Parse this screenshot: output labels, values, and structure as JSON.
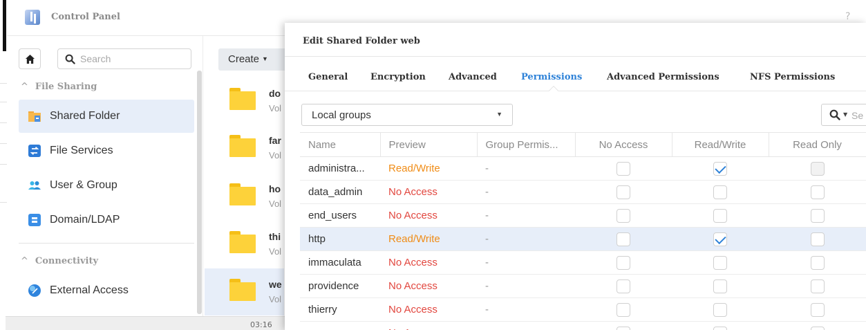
{
  "window": {
    "title": "Control Panel",
    "help": "?"
  },
  "sidebar": {
    "search_placeholder": "Search",
    "sections": [
      {
        "label": "File Sharing"
      },
      {
        "label": "Connectivity"
      }
    ],
    "items": [
      {
        "label": "Shared Folder",
        "icon": "shared-folder-icon",
        "active": true
      },
      {
        "label": "File Services",
        "icon": "file-services-icon"
      },
      {
        "label": "User & Group",
        "icon": "user-group-icon"
      },
      {
        "label": "Domain/LDAP",
        "icon": "domain-ldap-icon"
      },
      {
        "label": "External Access",
        "icon": "external-access-icon"
      }
    ]
  },
  "folder_list": {
    "create_label": "Create",
    "folders": [
      {
        "name": "do",
        "sub": "Vol"
      },
      {
        "name": "far",
        "sub": "Vol"
      },
      {
        "name": "ho",
        "sub": "Vol"
      },
      {
        "name": "thi",
        "sub": "Vol"
      },
      {
        "name": "we",
        "sub": "Vol",
        "selected": true
      }
    ]
  },
  "statusbar": {
    "time": "03:16"
  },
  "dialog": {
    "title": "Edit Shared Folder web",
    "tabs": [
      {
        "label": "General"
      },
      {
        "label": "Encryption"
      },
      {
        "label": "Advanced"
      },
      {
        "label": "Permissions",
        "active": true
      },
      {
        "label": "Advanced Permissions"
      },
      {
        "label": "NFS Permissions"
      }
    ],
    "group_select": {
      "value": "Local groups"
    },
    "filter_placeholder": "Se",
    "table": {
      "columns": [
        "Name",
        "Preview",
        "Group Permis...",
        "No Access",
        "Read/Write",
        "Read Only"
      ],
      "rows": [
        {
          "name": "administra...",
          "preview": "Read/Write",
          "group": "-",
          "no_access": false,
          "read_write": true,
          "read_only": false,
          "read_only_disabled": true
        },
        {
          "name": "data_admin",
          "preview": "No Access",
          "group": "-",
          "no_access": false,
          "read_write": false,
          "read_only": false
        },
        {
          "name": "end_users",
          "preview": "No Access",
          "group": "-",
          "no_access": false,
          "read_write": false,
          "read_only": false
        },
        {
          "name": "http",
          "preview": "Read/Write",
          "group": "-",
          "no_access": false,
          "read_write": true,
          "read_only": false,
          "selected": true
        },
        {
          "name": "immaculata",
          "preview": "No Access",
          "group": "-",
          "no_access": false,
          "read_write": false,
          "read_only": false
        },
        {
          "name": "providence",
          "preview": "No Access",
          "group": "-",
          "no_access": false,
          "read_write": false,
          "read_only": false
        },
        {
          "name": "thierry",
          "preview": "No Access",
          "group": "-",
          "no_access": false,
          "read_write": false,
          "read_only": false
        },
        {
          "name": "",
          "preview": "No Access",
          "group": "",
          "no_access": false,
          "read_write": false,
          "read_only": false
        }
      ]
    }
  }
}
